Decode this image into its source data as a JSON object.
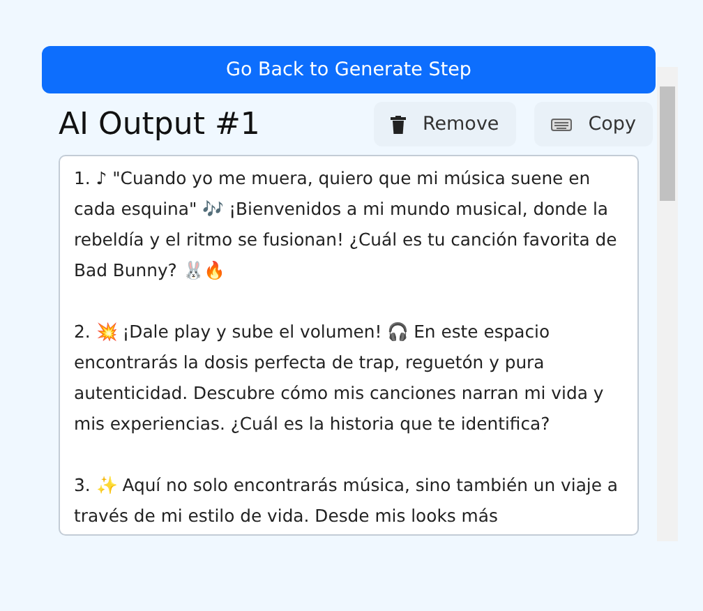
{
  "back_button": "Go Back to Generate Step",
  "output": {
    "title": "AI Output #1",
    "actions": [
      {
        "kind": "remove",
        "label": "Remove"
      },
      {
        "kind": "copy",
        "label": "Copy"
      }
    ],
    "paragraphs": [
      "1. ♪  \"Cuando yo me muera, quiero que mi música suene en cada esquina\" 🎶 ¡Bienvenidos a mi mundo musical, donde la rebeldía y el ritmo se fusionan! ¿Cuál es tu canción favorita de Bad Bunny? 🐰🔥",
      "2. 💥 ¡Dale play y sube el volumen! 🎧 En este espacio encontrarás la dosis perfecta de trap, reguetón y pura autenticidad. Descubre cómo mis canciones narran mi vida y mis experiencias. ¿Cuál es la historia que te identifica?",
      "3. ✨ Aquí no solo encontrarás música, sino también un viaje a través de mi estilo de vida. Desde mis looks más"
    ]
  }
}
